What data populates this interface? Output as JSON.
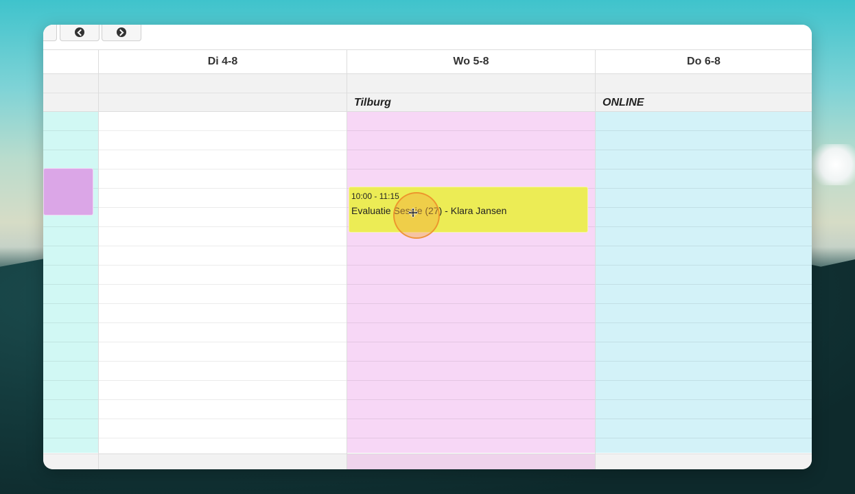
{
  "days": [
    {
      "label": "",
      "location": ""
    },
    {
      "label": "Di 4-8",
      "location": ""
    },
    {
      "label": "Wo 5-8",
      "location": "Tilburg"
    },
    {
      "label": "Do 6-8",
      "location": "ONLINE"
    }
  ],
  "event": {
    "time": "10:00 - 11:15",
    "title": "Evaluatie Sessie (27) - Klara Jansen"
  },
  "icons": {
    "prev": "arrow-left-circle-icon",
    "next": "arrow-right-circle-icon",
    "cursor": "move-cursor-icon"
  },
  "colors": {
    "col_monday": "#d1f8f4",
    "col_tuesday": "#ffffff",
    "col_wednesday": "#f7d7f6",
    "col_thursday": "#d3f2f8",
    "event_yellow": "#ecec55",
    "event_purple": "#dba6e7"
  }
}
